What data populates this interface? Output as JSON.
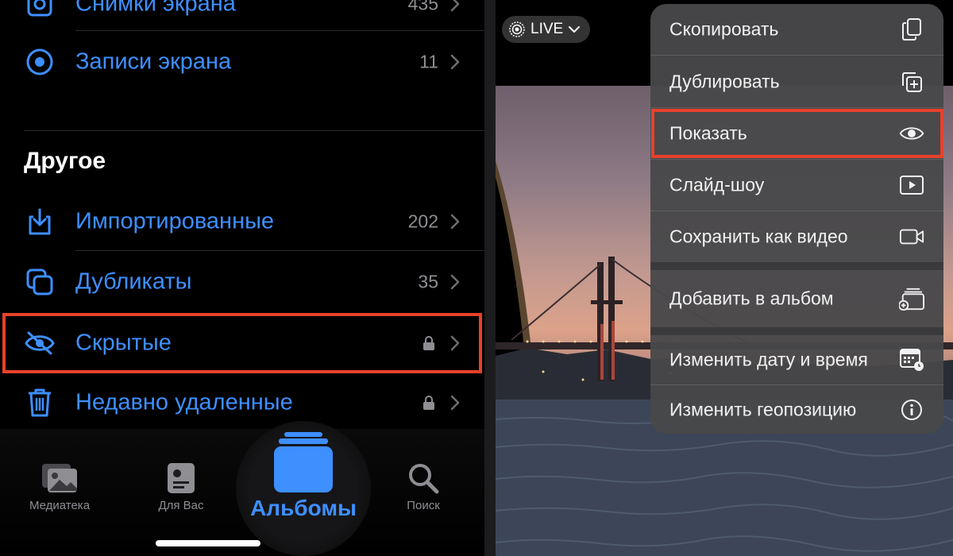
{
  "left": {
    "rows": [
      {
        "label": "Снимки экрана",
        "count": "435",
        "icon": "screenshot-icon"
      },
      {
        "label": "Записи экрана",
        "count": "11",
        "icon": "screen-record-icon"
      },
      {
        "label": "Импортированные",
        "count": "202",
        "icon": "import-icon"
      },
      {
        "label": "Дубликаты",
        "count": "35",
        "icon": "duplicates-icon"
      },
      {
        "label": "Скрытые",
        "icon": "eye-slash-icon",
        "locked": true
      },
      {
        "label": "Недавно удаленные",
        "icon": "trash-icon",
        "locked": true
      }
    ],
    "section_title": "Другое"
  },
  "tabbar": {
    "library": "Медиатека",
    "for_you": "Для Вас",
    "albums": "Альбомы",
    "search": "Поиск"
  },
  "right": {
    "live_label": "LIVE",
    "menu": [
      {
        "label": "Скопировать",
        "icon": "copy-icon"
      },
      {
        "label": "Дублировать",
        "icon": "duplicate-icon"
      },
      {
        "label": "Показать",
        "icon": "eye-icon"
      },
      {
        "label": "Слайд-шоу",
        "icon": "play-icon"
      },
      {
        "label": "Сохранить как видео",
        "icon": "video-icon"
      },
      {
        "label": "Добавить в альбом",
        "icon": "add-album-icon"
      },
      {
        "label": "Изменить дату и время",
        "icon": "calendar-icon"
      },
      {
        "label": "Изменить геопозицию",
        "icon": "info-icon"
      }
    ]
  },
  "colors": {
    "accent": "#3e8fff",
    "highlight": "#e8412b"
  }
}
